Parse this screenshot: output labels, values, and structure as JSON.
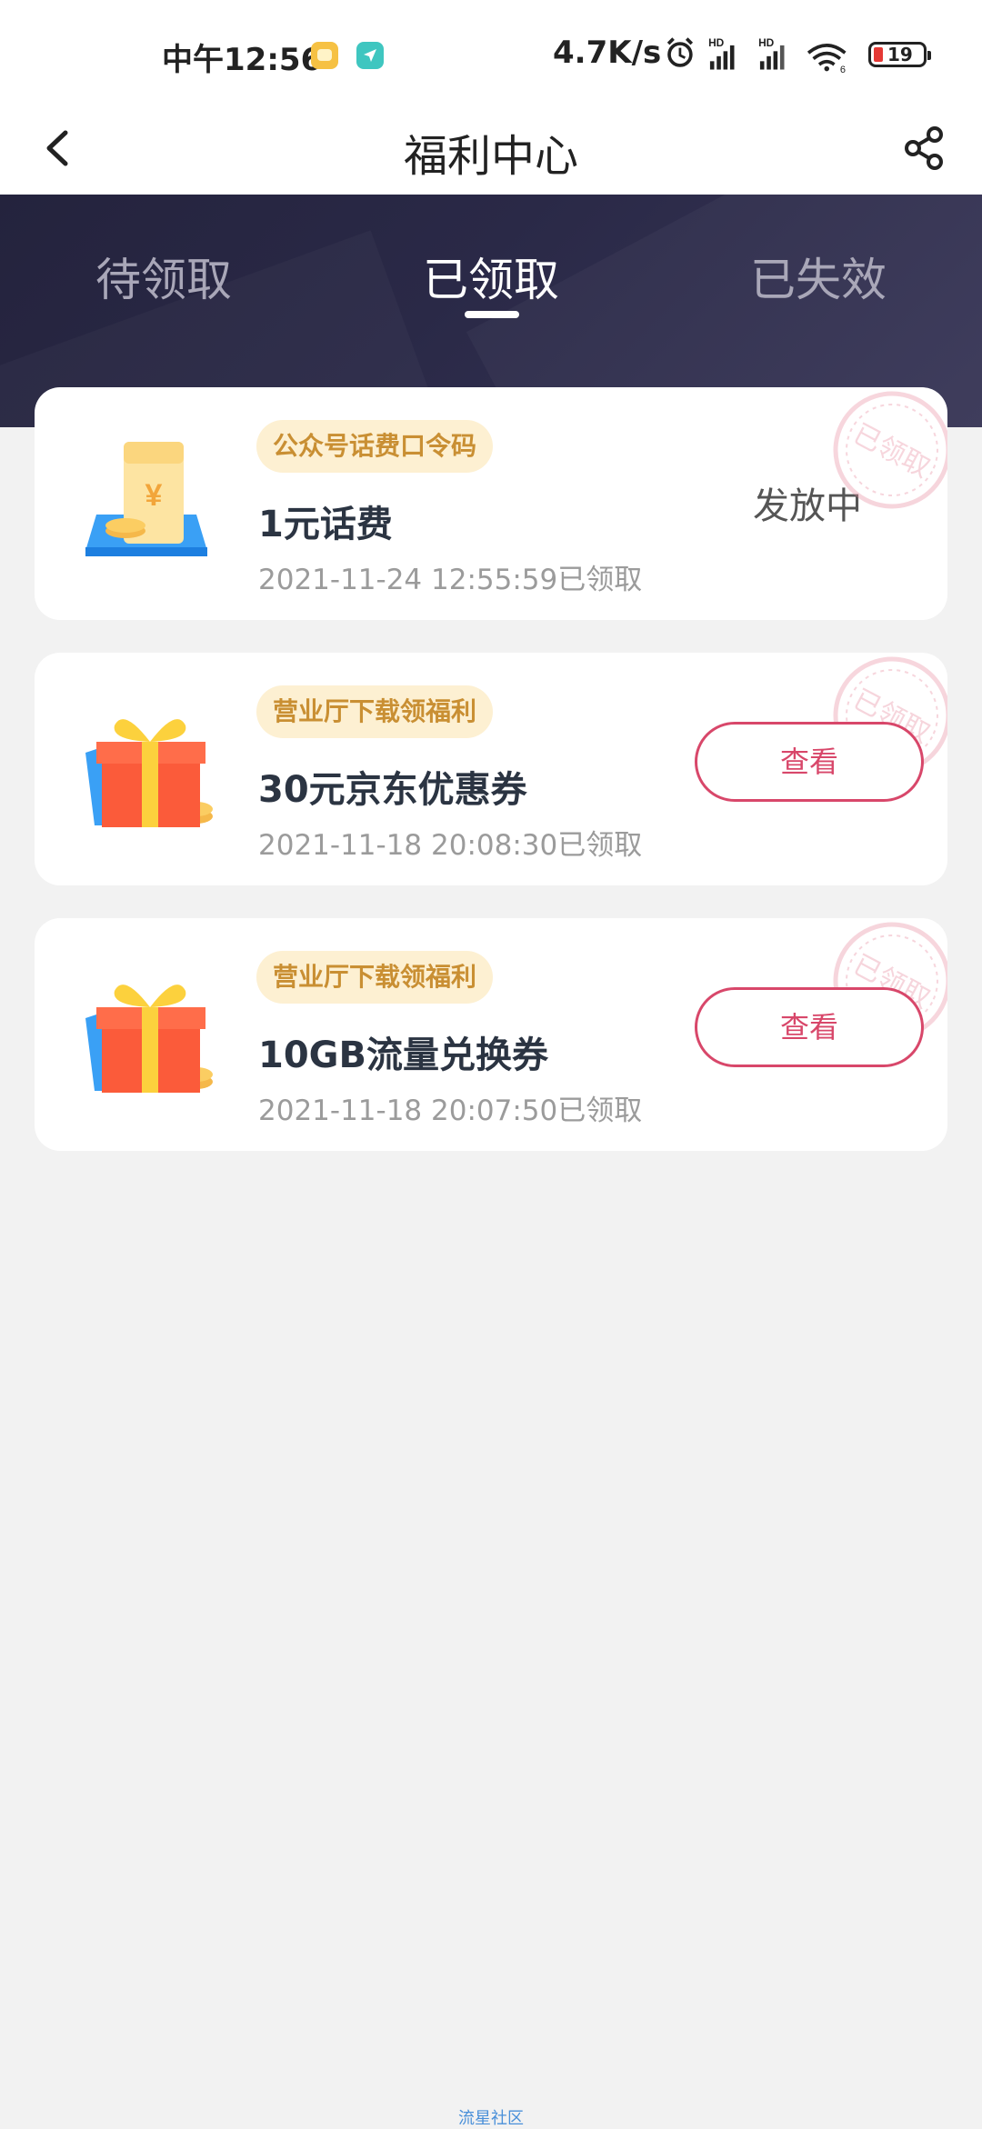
{
  "status_bar": {
    "time": "中午12:56",
    "net_speed": "4.7K/s",
    "hd1": "HD",
    "hd2": "HD",
    "wifi_badge": "6",
    "battery_level": "19"
  },
  "nav": {
    "title": "福利中心"
  },
  "tabs": [
    {
      "label": "待领取"
    },
    {
      "label": "已领取"
    },
    {
      "label": "已失效"
    }
  ],
  "selected_tab": "已领取",
  "cards": [
    {
      "tag": "公众号话费口令码",
      "title": "1元话费",
      "time": "2021-11-24 12:55:59已领取",
      "status": "发放中",
      "icon": "phone-bill-icon",
      "stamp": "已领取"
    },
    {
      "tag": "营业厅下载领福利",
      "title": "30元京东优惠券",
      "time": "2021-11-18 20:08:30已领取",
      "button": "查看",
      "icon": "gift-box-icon",
      "stamp": "已领取"
    },
    {
      "tag": "营业厅下载领福利",
      "title": "10GB流量兑换券",
      "time": "2021-11-18 20:07:50已领取",
      "button": "查看",
      "icon": "gift-box-icon",
      "stamp": "已领取"
    }
  ],
  "footer": {
    "watermark": "流星社区"
  },
  "colors": {
    "header_bg": "#2a2947",
    "accent": "#d8476a",
    "tag_bg": "#fdf0d2",
    "tag_text": "#c98f33",
    "page_bg": "#f2f2f2"
  }
}
